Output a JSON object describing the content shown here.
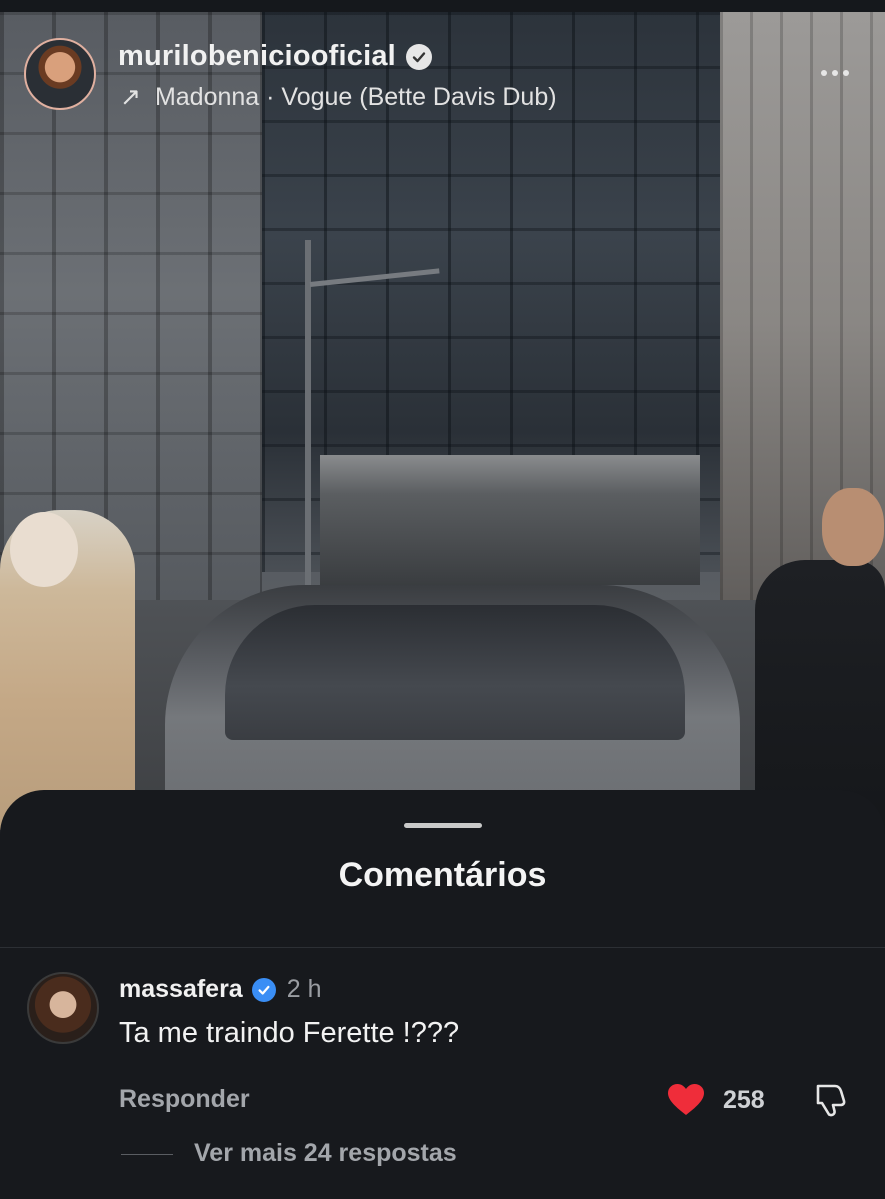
{
  "post": {
    "username": "murilobeniciooficial",
    "audio_arrow": "↗",
    "audio_label": "Madonna · Vogue (Bette Davis Dub)"
  },
  "comments_sheet": {
    "title": "Comentários",
    "comment": {
      "username": "massafera",
      "time": "2 h",
      "text": "Ta me traindo Ferette !???",
      "reply_label": "Responder",
      "like_count": "258",
      "more_replies_label": "Ver mais 24 respostas"
    }
  },
  "colors": {
    "sheet_bg": "#17191d",
    "like_red": "#ef2d3a",
    "verified_blue": "#3a8ef5"
  },
  "icons": {
    "verified": "verified-badge-icon",
    "audio": "arrow-up-right-icon",
    "more": "ellipsis-icon",
    "like": "heart-icon",
    "dislike": "thumbs-down-icon"
  }
}
